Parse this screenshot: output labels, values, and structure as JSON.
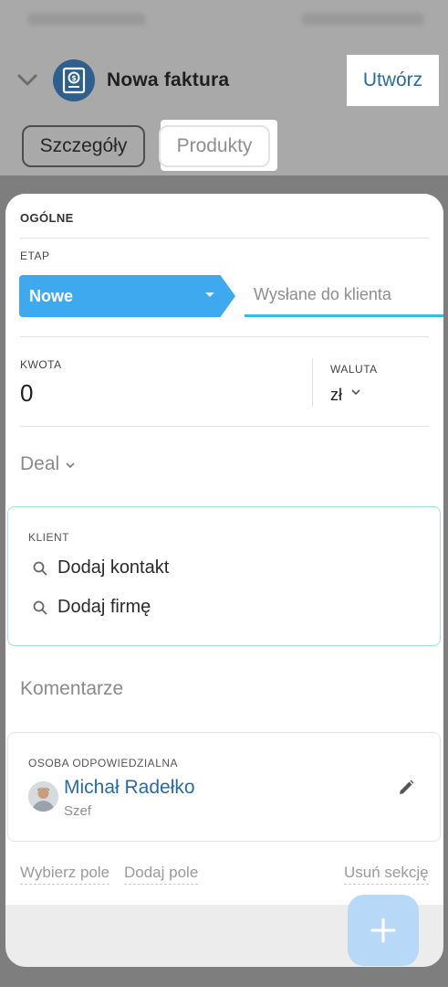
{
  "header": {
    "title": "Nowa faktura",
    "create_label": "Utwórz",
    "tabs": [
      {
        "label": "Szczegóły"
      },
      {
        "label": "Produkty"
      }
    ]
  },
  "form": {
    "section_title": "OGÓLNE",
    "stage": {
      "label": "ETAP",
      "active": "Nowe",
      "next": "Wysłane do klienta"
    },
    "amount": {
      "label": "KWOTA",
      "value": "0"
    },
    "currency": {
      "label": "WALUTA",
      "value": "zł"
    },
    "deal": "Deal",
    "client": {
      "label": "KLIENT",
      "add_contact": "Dodaj kontakt",
      "add_company": "Dodaj firmę"
    },
    "comments": "Komentarze",
    "responsible": {
      "label": "OSOBA ODPOWIEDZIALNA",
      "name": "Michał Radełko",
      "role": "Szef"
    }
  },
  "footer": {
    "select_field": "Wybierz pole",
    "add_field": "Dodaj pole",
    "delete_section": "Usuń sekcję"
  },
  "colors": {
    "stage_active": "#3fa9ef",
    "accent_link": "#2c6aa0",
    "stage_underline": "#2ec1dc",
    "fab": "#b7d8f7"
  },
  "icons": [
    "chevron-down-icon",
    "invoice-icon",
    "search-icon",
    "pencil-icon",
    "plus-icon"
  ]
}
